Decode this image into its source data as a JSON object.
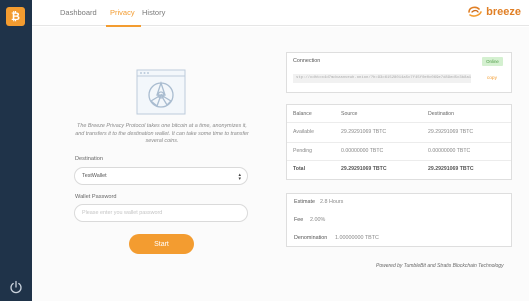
{
  "sidebar": {
    "logo_glyph": "₿",
    "power_icon": "power-icon"
  },
  "nav": {
    "tabs": [
      {
        "label": "Dashboard"
      },
      {
        "label": "Privacy"
      },
      {
        "label": "History"
      }
    ],
    "active_tab": "Privacy",
    "brand": "breeze"
  },
  "privacy": {
    "description": "The Breeze Privacy Protocol takes one bitcoin at a time, anonymizes it, and transfers it to the destination wallet. It can take some time to transfer several coins.",
    "destination_label": "Destination",
    "destination_value": "TestWallet",
    "password_label": "Wallet Password",
    "password_placeholder": "Please enter you wallet password",
    "start_label": "Start"
  },
  "connection": {
    "title": "Connection",
    "status": "Online",
    "address": "stp://cdhtcx4d7mdxzanveuh.onion/?h=93c61528014a5c7f45f0e0c069e7d89ed5c3b8a1a7e39c46fd9d3ab0a88c4f62",
    "copy_label": "copy"
  },
  "balance": {
    "headers": [
      "Balance",
      "Source",
      "Destination"
    ],
    "rows": [
      {
        "label": "Available",
        "source": "29.29291069 TBTC",
        "destination": "29.29291069 TBTC"
      },
      {
        "label": "Pending",
        "source": "0.00000000 TBTC",
        "destination": "0.00000000 TBTC"
      },
      {
        "label": "Total",
        "source": "29.29291069 TBTC",
        "destination": "29.29291069 TBTC"
      }
    ]
  },
  "estimates": {
    "estimate_label": "Estimate",
    "estimate_value": "2.8 Hours",
    "fee_label": "Fee",
    "fee_value": "2.00%",
    "denomination_label": "Denomination",
    "denomination_value": "1.00000000 TBTC"
  },
  "footer": "Powered by TumbleBit and Stratis Blockchain Technology",
  "colors": {
    "accent": "#f39c30",
    "sidebar": "#1f3349",
    "online": "#4e9b47"
  }
}
